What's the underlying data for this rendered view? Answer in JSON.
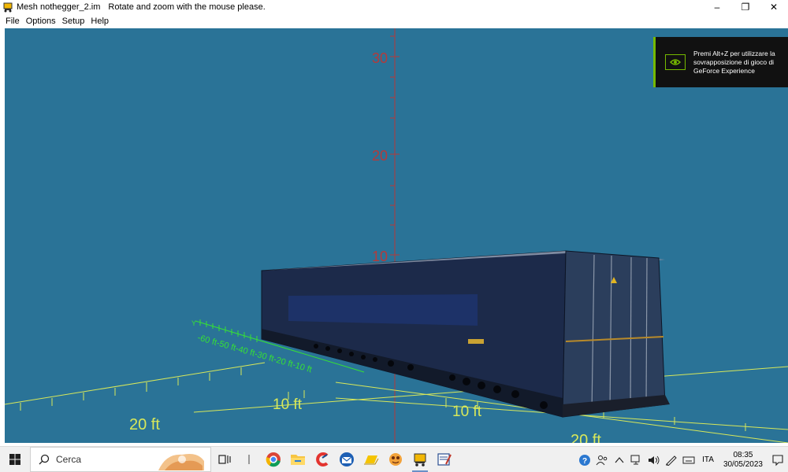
{
  "window": {
    "title": "Mesh nothegger_2.im",
    "hint": "Rotate and zoom with the mouse please.",
    "controls": {
      "minimize": "–",
      "restore": "❐",
      "close": "✕"
    }
  },
  "menu": {
    "items": [
      "File",
      "Options",
      "Setup",
      "Help"
    ]
  },
  "scene": {
    "vertical_axis_labels": [
      "30",
      "20",
      "10"
    ],
    "x_axis_labels": [
      "-60 ft",
      "-50 ft",
      "-40 ft",
      "-30 ft",
      "-20 ft",
      "-10 ft"
    ],
    "x_axis_label_full": "-60 ft-50 ft-40 ft-30 ft-20 ft-10 ft",
    "floor_labels": [
      "20 ft",
      "10 ft",
      "10 ft",
      "20 ft"
    ],
    "y_axis_letter": "Y"
  },
  "overlay": {
    "text": "Premi Alt+Z per utilizzare la sovrapposizione di gioco di GeForce Experience"
  },
  "taskbar": {
    "search_placeholder": "Cerca",
    "language": "ITA",
    "time": "08:35",
    "date": "30/05/2023"
  },
  "colors": {
    "viewport_bg": "#2a7397",
    "axis_red": "#b53a3a",
    "axis_green": "#36e036",
    "floor_yellow": "#d8e85a",
    "nvidia_green": "#76b900"
  }
}
